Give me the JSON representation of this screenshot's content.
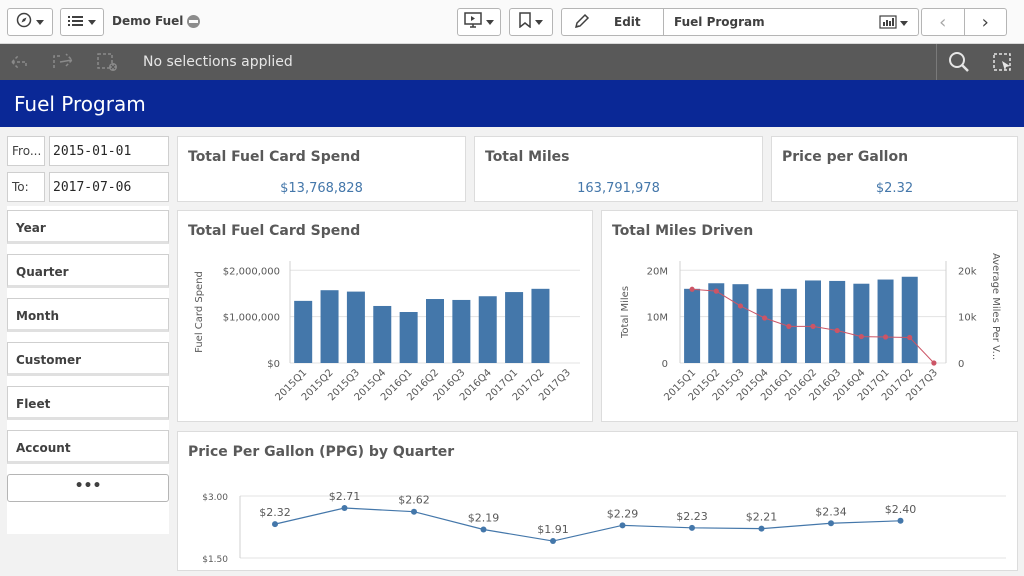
{
  "app": {
    "name": "Demo Fuel"
  },
  "toolbar": {
    "edit_label": "Edit",
    "sheet_name": "Fuel Program"
  },
  "selections": {
    "text": "No selections applied"
  },
  "sheet": {
    "title": "Fuel Program"
  },
  "filters": {
    "date_from": {
      "label": "Fro...",
      "value": "2015-01-01"
    },
    "date_to": {
      "label": "To:",
      "value": "2017-07-06"
    },
    "items": [
      "Year",
      "Quarter",
      "Month",
      "Customer",
      "Fleet",
      "Account"
    ],
    "more_label": "•••"
  },
  "kpis": [
    {
      "title": "Total Fuel Card Spend",
      "value": "$13,768,828"
    },
    {
      "title": "Total Miles",
      "value": "163,791,978"
    },
    {
      "title": "Price per Gallon",
      "value": "$2.32"
    }
  ],
  "colors": {
    "bar": "#4477aa",
    "line_red": "#cc5566",
    "accent": "#0a2896"
  },
  "chart_data": [
    {
      "type": "bar",
      "title": "Total Fuel Card Spend",
      "ylabel": "Fuel Card Spend",
      "xlabel": "",
      "categories": [
        "2015Q1",
        "2015Q2",
        "2015Q3",
        "2015Q4",
        "2016Q1",
        "2016Q2",
        "2016Q3",
        "2016Q4",
        "2017Q1",
        "2017Q2",
        "2017Q3"
      ],
      "values": [
        1340000,
        1570000,
        1540000,
        1230000,
        1100000,
        1380000,
        1360000,
        1440000,
        1530000,
        1600000
      ],
      "yticks": [
        "$0",
        "$1,000,000",
        "$2,000,000"
      ],
      "ylim": [
        0,
        2200000
      ],
      "grid": true
    },
    {
      "type": "bar",
      "title": "Total Miles Driven",
      "ylabel": "Total Miles",
      "y2label": "Average Miles Per V...",
      "categories": [
        "2015Q1",
        "2015Q2",
        "2015Q3",
        "2015Q4",
        "2016Q1",
        "2016Q2",
        "2016Q3",
        "2016Q4",
        "2017Q1",
        "2017Q2",
        "2017Q3"
      ],
      "series": [
        {
          "type": "bar",
          "axis": "left",
          "values": [
            16000000,
            17200000,
            17000000,
            16000000,
            16000000,
            17800000,
            17700000,
            17100000,
            18000000,
            18600000
          ]
        },
        {
          "type": "line",
          "axis": "right",
          "values": [
            15900,
            15500,
            12300,
            9700,
            7900,
            7900,
            7000,
            5700,
            5600,
            5500,
            0
          ]
        }
      ],
      "yticks": [
        "0",
        "10M",
        "20M"
      ],
      "y2ticks": [
        "0",
        "10k",
        "20k"
      ],
      "ylim": [
        0,
        22000000
      ],
      "y2lim": [
        0,
        22000
      ],
      "grid": true
    },
    {
      "type": "line",
      "title": "Price Per Gallon (PPG) by Quarter",
      "values": [
        2.32,
        2.71,
        2.62,
        2.19,
        1.91,
        2.29,
        2.23,
        2.21,
        2.34,
        2.4
      ],
      "labels": [
        "$2.32",
        "$2.71",
        "$2.62",
        "$2.19",
        "$1.91",
        "$2.29",
        "$2.23",
        "$2.21",
        "$2.34",
        "$2.40"
      ],
      "yticks": [
        "$1.50",
        "$3.00"
      ],
      "ylim": [
        1.5,
        3.0
      ],
      "grid": true
    }
  ]
}
